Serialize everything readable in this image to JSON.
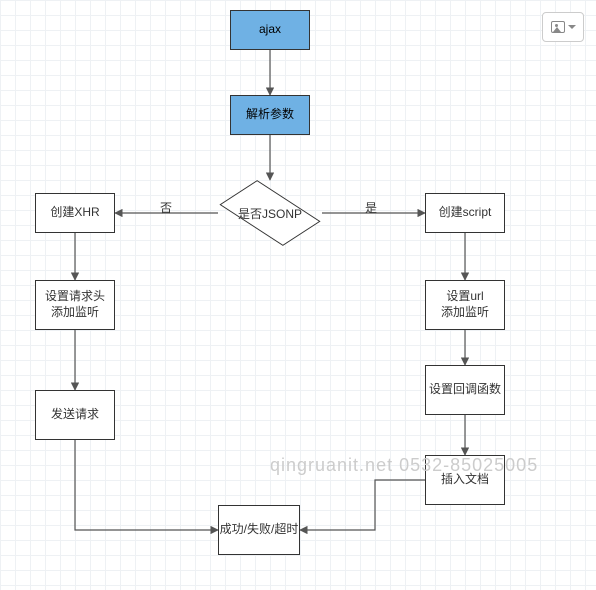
{
  "nodes": {
    "ajax": {
      "label": "ajax"
    },
    "parse": {
      "label": "解析参数"
    },
    "jsonp": {
      "label": "是否JSONP"
    },
    "xhr": {
      "label": "创建XHR"
    },
    "script": {
      "label": "创建script"
    },
    "setHeader": {
      "label": "设置请求头\n添加监听"
    },
    "setUrl": {
      "label": "设置url\n添加监听"
    },
    "send": {
      "label": "发送请求"
    },
    "callback": {
      "label": "设置回调函数"
    },
    "insert": {
      "label": "插入文档"
    },
    "result": {
      "label": "成功/失败/超时"
    }
  },
  "edges": {
    "no": "否",
    "yes": "是"
  },
  "watermark": "qingruanit.net 0532-85025005",
  "toolbar": {
    "image_button": "image"
  },
  "chart_data": {
    "type": "flowchart",
    "nodes": [
      {
        "id": "ajax",
        "label": "ajax",
        "shape": "process",
        "style": "blue"
      },
      {
        "id": "parse",
        "label": "解析参数",
        "shape": "process",
        "style": "blue"
      },
      {
        "id": "jsonp",
        "label": "是否JSONP",
        "shape": "decision"
      },
      {
        "id": "xhr",
        "label": "创建XHR",
        "shape": "process"
      },
      {
        "id": "script",
        "label": "创建script",
        "shape": "process"
      },
      {
        "id": "setHeader",
        "label": "设置请求头 添加监听",
        "shape": "process"
      },
      {
        "id": "setUrl",
        "label": "设置url 添加监听",
        "shape": "process"
      },
      {
        "id": "send",
        "label": "发送请求",
        "shape": "process"
      },
      {
        "id": "callback",
        "label": "设置回调函数",
        "shape": "process"
      },
      {
        "id": "insert",
        "label": "插入文档",
        "shape": "process"
      },
      {
        "id": "result",
        "label": "成功/失败/超时",
        "shape": "process"
      }
    ],
    "edges": [
      {
        "from": "ajax",
        "to": "parse"
      },
      {
        "from": "parse",
        "to": "jsonp"
      },
      {
        "from": "jsonp",
        "to": "xhr",
        "label": "否"
      },
      {
        "from": "jsonp",
        "to": "script",
        "label": "是"
      },
      {
        "from": "xhr",
        "to": "setHeader"
      },
      {
        "from": "script",
        "to": "setUrl"
      },
      {
        "from": "setHeader",
        "to": "send"
      },
      {
        "from": "setUrl",
        "to": "callback"
      },
      {
        "from": "send",
        "to": "result"
      },
      {
        "from": "callback",
        "to": "insert"
      },
      {
        "from": "insert",
        "to": "result"
      }
    ]
  }
}
